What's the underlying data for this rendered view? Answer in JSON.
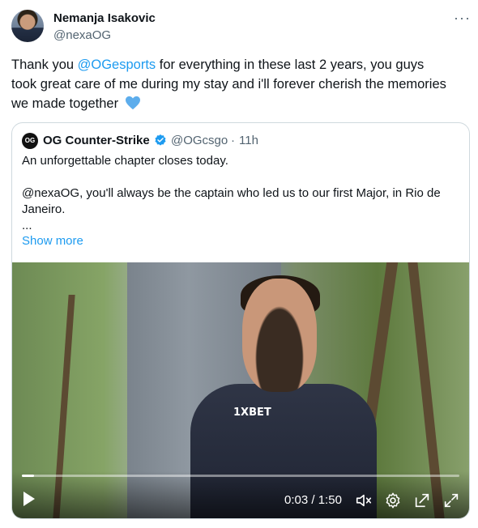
{
  "author": {
    "name": "Nemanja Isakovic",
    "handle": "@nexaOG"
  },
  "more_menu": "···",
  "tweet_text": {
    "part1": "Thank you ",
    "mention": "@OGesports",
    "part2": " for everything in these last 2 years, you guys took great care of me during my stay and i'll forever cherish the memories we made together"
  },
  "heart_icon": "blue-heart-emoji",
  "quoted": {
    "avatar_text": "OG",
    "name": "OG Counter-Strike",
    "handle": "@OGcsgo",
    "separator": "·",
    "time": "11h",
    "lines": [
      "An unforgettable chapter closes today.",
      "@nexaOG, you'll always be the captain who led us to our first Major, in Rio de",
      "Janeiro.",
      "..."
    ],
    "show_more": "Show more"
  },
  "video": {
    "current_time": "0:03",
    "time_separator": " / ",
    "duration": "1:50",
    "progress": 0.027,
    "sponsor": "1XBET",
    "controls": [
      "play-icon",
      "mute-icon",
      "settings-icon",
      "pop-out-icon",
      "fullscreen-icon"
    ]
  },
  "colors": {
    "accent": "#1d9bf0",
    "text": "#0f1419",
    "muted": "#536471",
    "border": "#cfd9de"
  }
}
